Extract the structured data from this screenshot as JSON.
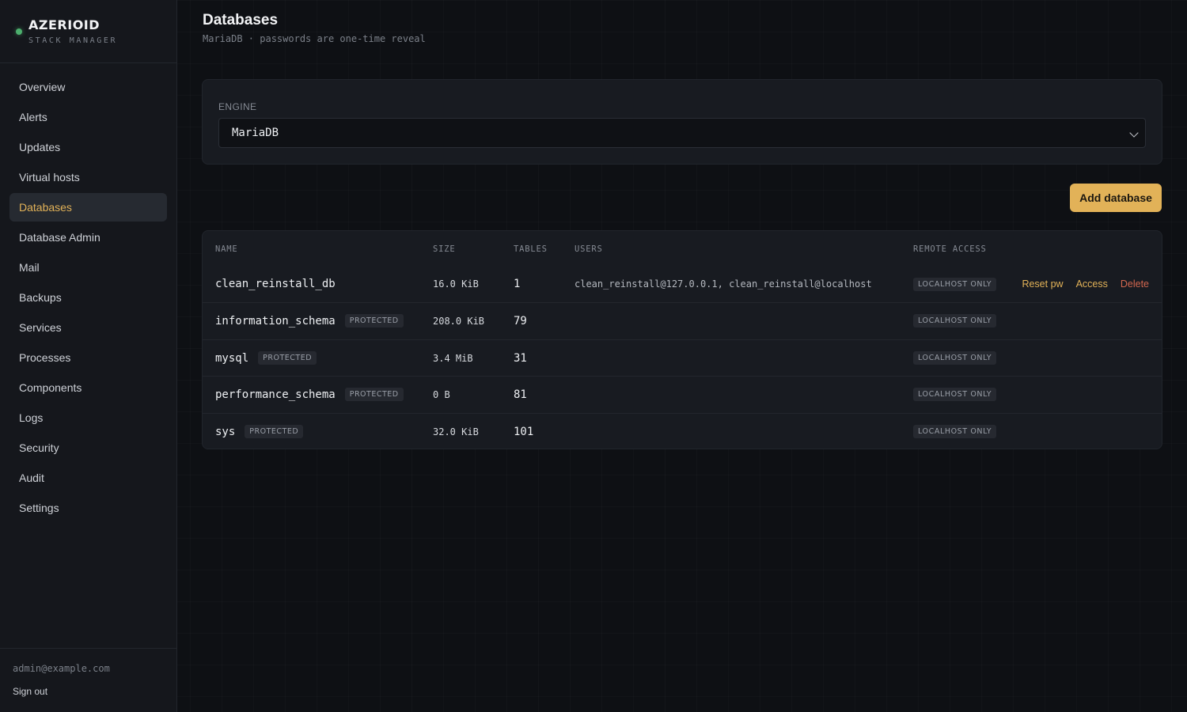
{
  "brand": {
    "name": "AZERIOID",
    "subtitle": "STACK MANAGER",
    "status_color": "#4caf6d"
  },
  "sidebar": {
    "items": [
      {
        "label": "Overview"
      },
      {
        "label": "Alerts"
      },
      {
        "label": "Updates"
      },
      {
        "label": "Virtual hosts"
      },
      {
        "label": "Databases",
        "active": true
      },
      {
        "label": "Database Admin"
      },
      {
        "label": "Mail"
      },
      {
        "label": "Backups"
      },
      {
        "label": "Services"
      },
      {
        "label": "Processes"
      },
      {
        "label": "Components"
      },
      {
        "label": "Logs"
      },
      {
        "label": "Security"
      },
      {
        "label": "Audit"
      },
      {
        "label": "Settings"
      }
    ],
    "footer": {
      "email": "admin@example.com",
      "signout": "Sign out"
    }
  },
  "header": {
    "title": "Databases",
    "subtitle": "MariaDB · passwords are one-time reveal"
  },
  "engine": {
    "label": "ENGINE",
    "selected": "MariaDB"
  },
  "actions": {
    "add_label": "Add database"
  },
  "table": {
    "columns": [
      "NAME",
      "SIZE",
      "TABLES",
      "USERS",
      "REMOTE ACCESS"
    ],
    "rows": [
      {
        "name": "clean_reinstall_db",
        "protected": "",
        "size": "16.0 KiB",
        "tables": "1",
        "users": "clean_reinstall@127.0.0.1, clean_reinstall@localhost",
        "remote": "LOCALHOST ONLY",
        "actions": {
          "reset": "Reset pw",
          "access": "Access",
          "delete": "Delete"
        }
      },
      {
        "name": "information_schema",
        "protected": "PROTECTED",
        "size": "208.0 KiB",
        "tables": "79",
        "users": "",
        "remote": "LOCALHOST ONLY"
      },
      {
        "name": "mysql",
        "protected": "PROTECTED",
        "size": "3.4 MiB",
        "tables": "31",
        "users": "",
        "remote": "LOCALHOST ONLY"
      },
      {
        "name": "performance_schema",
        "protected": "PROTECTED",
        "size": "0 B",
        "tables": "81",
        "users": "",
        "remote": "LOCALHOST ONLY"
      },
      {
        "name": "sys",
        "protected": "PROTECTED",
        "size": "32.0 KiB",
        "tables": "101",
        "users": "",
        "remote": "LOCALHOST ONLY"
      }
    ]
  },
  "colors": {
    "accent": "#e2b258",
    "danger": "#d3674f",
    "background": "#0e1014",
    "sidebar": "#15171c"
  }
}
